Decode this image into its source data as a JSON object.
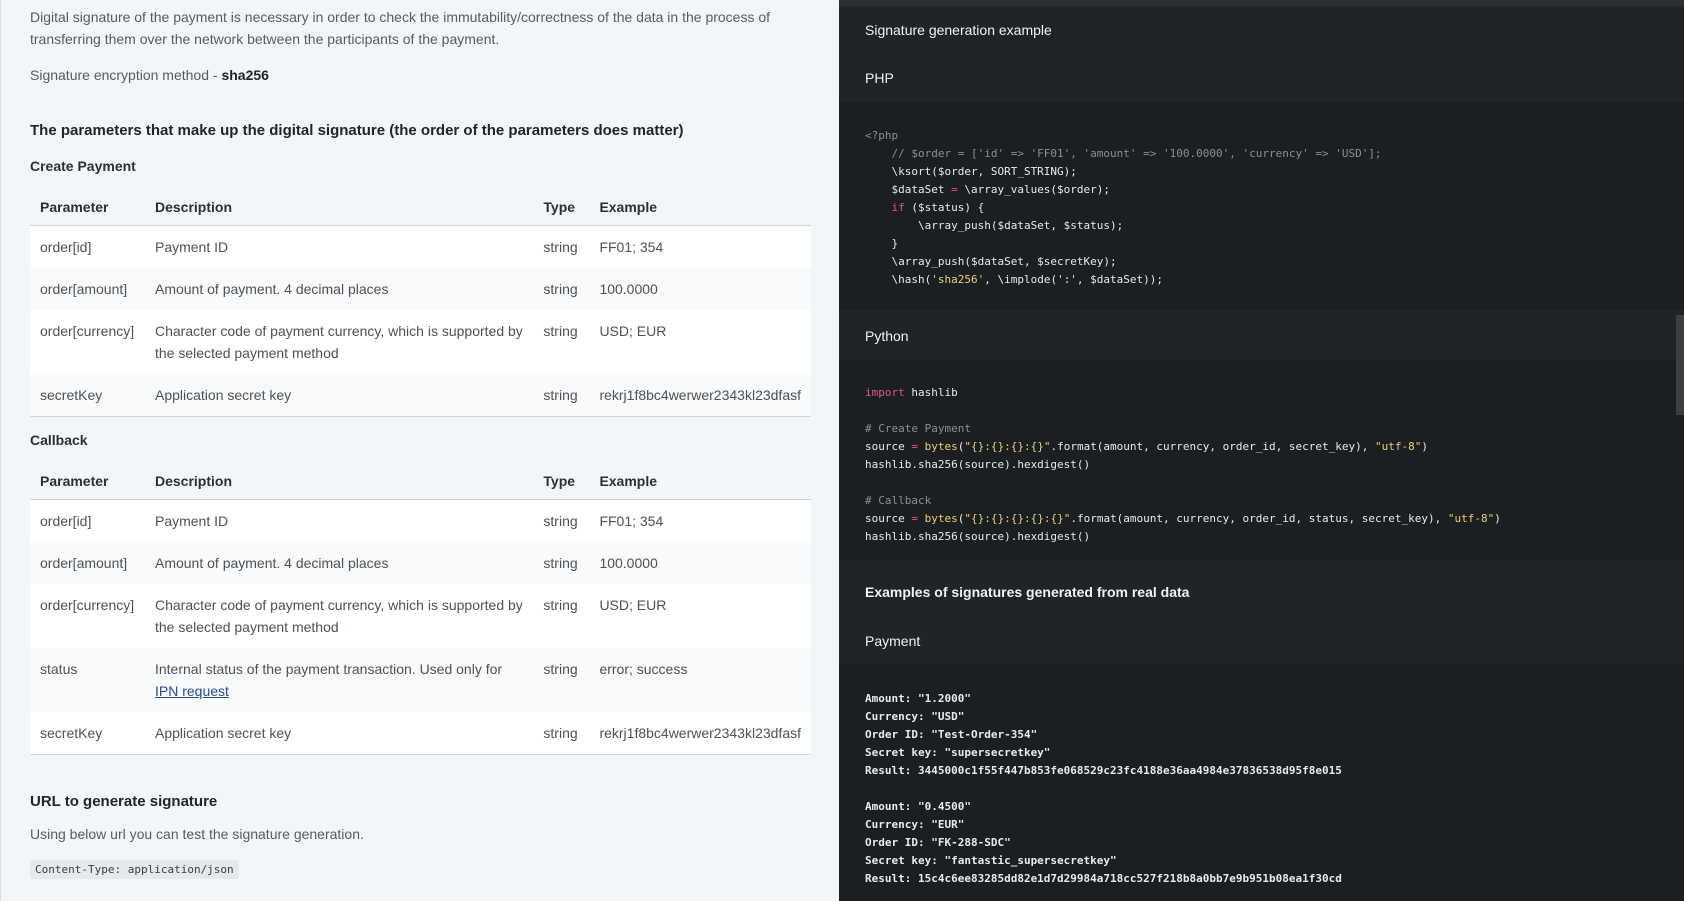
{
  "intro": {
    "text": "Digital signature of the payment is necessary in order to check the immutability/correctness of the data in the process of transferring them over the network between the participants of the payment.",
    "method_label": "Signature encryption method - ",
    "method_value": "sha256"
  },
  "params_title": "The parameters that make up the digital signature (the order of the parameters does matter)",
  "create_payment": {
    "title": "Create Payment",
    "headers": [
      "Parameter",
      "Description",
      "Type",
      "Example"
    ],
    "rows": [
      {
        "param": "order[id]",
        "desc": "Payment ID",
        "type": "string",
        "example": "FF01; 354"
      },
      {
        "param": "order[amount]",
        "desc": "Amount of payment. 4 decimal places",
        "type": "string",
        "example": "100.0000"
      },
      {
        "param": "order[currency]",
        "desc": "Character code of payment currency, which is supported by the selected payment method",
        "type": "string",
        "example": "USD; EUR"
      },
      {
        "param": "secretKey",
        "desc": "Application secret key",
        "type": "string",
        "example": "rekrj1f8bc4werwer2343kl23dfasf"
      }
    ]
  },
  "callback": {
    "title": "Callback",
    "headers": [
      "Parameter",
      "Description",
      "Type",
      "Example"
    ],
    "rows": [
      {
        "param": "order[id]",
        "desc": "Payment ID",
        "type": "string",
        "example": "FF01; 354"
      },
      {
        "param": "order[amount]",
        "desc": "Amount of payment. 4 decimal places",
        "type": "string",
        "example": "100.0000"
      },
      {
        "param": "order[currency]",
        "desc": "Character code of payment currency, which is supported by the selected payment method",
        "type": "string",
        "example": "USD; EUR"
      },
      {
        "param": "status",
        "desc": "Internal status of the payment transaction. Used only for",
        "link": "IPN request",
        "type": "string",
        "example": "error; success"
      },
      {
        "param": "secretKey",
        "desc": "Application secret key",
        "type": "string",
        "example": "rekrj1f8bc4werwer2343kl23dfasf"
      }
    ]
  },
  "url_section": {
    "title": "URL to generate signature",
    "text": "Using below url you can test the signature generation.",
    "content_type": "Content-Type: application/json"
  },
  "right": {
    "title": "Signature generation example",
    "php_label": "PHP",
    "php_open": "<?php",
    "php_comment": "    // $order = ['id' => 'FF01', 'amount' => '100.0000', 'currency' => 'USD'];",
    "php_l1": "    \\ksort($order, SORT_STRING);",
    "php_l2a": "    $dataSet ",
    "php_l2b": "=",
    "php_l2c": " \\array_values($order);",
    "php_l3a": "    ",
    "php_l3b": "if",
    "php_l3c": " ($status) {",
    "php_l4": "        \\array_push($dataSet, $status);",
    "php_l5": "    }",
    "php_l6": "    \\array_push($dataSet, $secretKey);",
    "php_l7a": "    \\hash(",
    "php_l7b": "'sha256'",
    "php_l7c": ", \\implode(':', $dataSet));",
    "python_label": "Python",
    "py_import_kw": "import",
    "py_import_mod": " hashlib",
    "py_c1": "# Create Payment",
    "py_s1a": "source ",
    "py_s1b": "=",
    "py_s1c": " ",
    "py_s1d": "bytes",
    "py_s1e": "(",
    "py_s1f": "\"{}:{}:{}:{}\"",
    "py_s1g": ".format(amount, currency, order_id, secret_key), ",
    "py_s1h": "\"utf-8\"",
    "py_s1i": ")",
    "py_h1": "hashlib.sha256(source).hexdigest()",
    "py_c2": "# Callback",
    "py_s2a": "source ",
    "py_s2b": "=",
    "py_s2c": " ",
    "py_s2d": "bytes",
    "py_s2e": "(",
    "py_s2f": "\"{}:{}:{}:{}:{}\"",
    "py_s2g": ".format(amount, currency, order_id, status, secret_key), ",
    "py_s2h": "\"utf-8\"",
    "py_s2i": ")",
    "py_h2": "hashlib.sha256(source).hexdigest()",
    "examples_title": "Examples of signatures generated from real data",
    "payment_label": "Payment",
    "ex1": [
      "Amount: \"1.2000\"",
      "Currency: \"USD\"",
      "Order ID: \"Test-Order-354\"",
      "Secret key: \"supersecretkey\"",
      "Result: 3445000c1f55f447b853fe068529c23fc4188e36aa4984e37836538d95f8e015"
    ],
    "ex2": [
      "Amount: \"0.4500\"",
      "Currency: \"EUR\"",
      "Order ID: \"FK-288-SDC\"",
      "Secret key: \"fantastic_supersecretkey\"",
      "Result: 15c4c6ee83285dd82e1d7d29984a718cc527f218b8a0bb7e9b951b08ea1f30cd"
    ]
  }
}
